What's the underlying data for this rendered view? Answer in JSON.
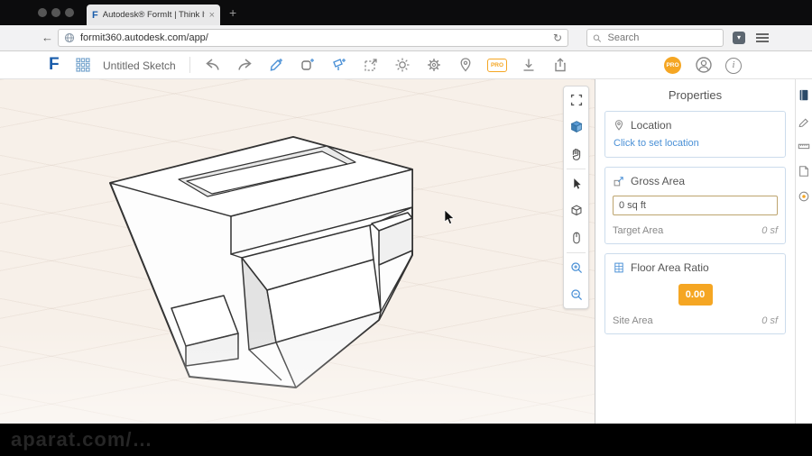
{
  "browser": {
    "tab_title": "Autodesk® FormIt | Think It...",
    "tab_close": "×",
    "new_tab": "+",
    "back_arrow": "←",
    "reload": "↻",
    "url": "formit360.autodesk.com/app/",
    "search_placeholder": "Search"
  },
  "appbar": {
    "logo_letter": "F",
    "sketch_title": "Untitled Sketch",
    "pro_cloud_label": "PRO",
    "pro_badge": "PRO",
    "info_glyph": "i"
  },
  "properties": {
    "title": "Properties",
    "location": {
      "label": "Location",
      "link": "Click to set location"
    },
    "gross_area": {
      "label": "Gross Area",
      "value": "0 sq ft",
      "target_label": "Target Area",
      "target_value": "0 sf"
    },
    "floor_area_ratio": {
      "label": "Floor Area Ratio",
      "value": "0.00",
      "site_label": "Site Area",
      "site_value": "0 sf"
    }
  },
  "watermark": "aparat.com/…",
  "colors": {
    "accent_blue": "#4a90d6",
    "brand_blue": "#1a5dab",
    "orange": "#f5a623",
    "canvas_bg": "#f7f0e9"
  }
}
